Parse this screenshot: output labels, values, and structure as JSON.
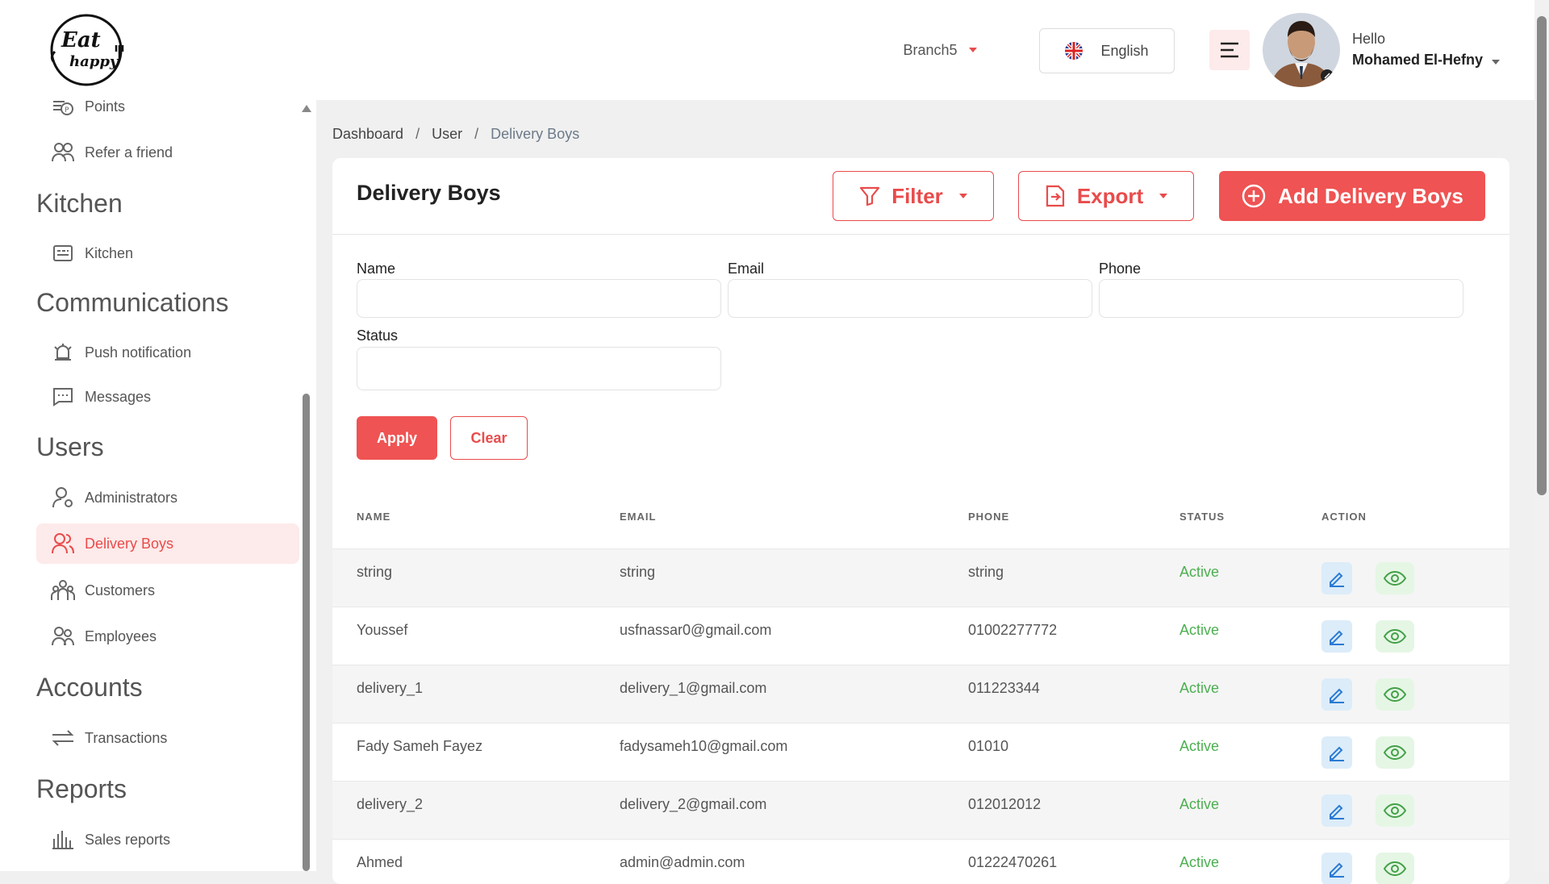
{
  "logo": {
    "line1": "Eat",
    "line2": "happy"
  },
  "sidebar": {
    "items_top": [
      {
        "label": "Points",
        "icon": "points-icon"
      },
      {
        "label": "Refer a friend",
        "icon": "refer-friend-icon"
      }
    ],
    "sections": [
      {
        "title": "Kitchen",
        "items": [
          {
            "label": "Kitchen",
            "icon": "kitchen-icon"
          }
        ]
      },
      {
        "title": "Communications",
        "items": [
          {
            "label": "Push notification",
            "icon": "bell-icon"
          },
          {
            "label": "Messages",
            "icon": "message-icon"
          }
        ]
      },
      {
        "title": "Users",
        "items": [
          {
            "label": "Administrators",
            "icon": "admin-icon"
          },
          {
            "label": "Delivery Boys",
            "icon": "delivery-icon",
            "active": true
          },
          {
            "label": "Customers",
            "icon": "customers-icon"
          },
          {
            "label": "Employees",
            "icon": "employees-icon"
          }
        ]
      },
      {
        "title": "Accounts",
        "items": [
          {
            "label": "Transactions",
            "icon": "transactions-icon"
          }
        ]
      },
      {
        "title": "Reports",
        "items": [
          {
            "label": "Sales reports",
            "icon": "sales-reports-icon"
          }
        ]
      }
    ]
  },
  "topbar": {
    "branch": "Branch5",
    "language": "English",
    "greeting": "Hello",
    "user_name": "Mohamed El-Hefny"
  },
  "breadcrumb": {
    "items": [
      "Dashboard",
      "User"
    ],
    "current": "Delivery Boys"
  },
  "page": {
    "title": "Delivery Boys",
    "filter_label": "Filter",
    "export_label": "Export",
    "add_label": "Add Delivery Boys"
  },
  "filters": {
    "name_label": "Name",
    "email_label": "Email",
    "phone_label": "Phone",
    "status_label": "Status",
    "apply_label": "Apply",
    "clear_label": "Clear"
  },
  "table": {
    "columns": [
      "NAME",
      "EMAIL",
      "PHONE",
      "STATUS",
      "ACTION"
    ],
    "rows": [
      {
        "name": "string",
        "email": "string",
        "phone": "string",
        "status": "Active"
      },
      {
        "name": "Youssef",
        "email": "usfnassar0@gmail.com",
        "phone": "01002277772",
        "status": "Active"
      },
      {
        "name": "delivery_1",
        "email": "delivery_1@gmail.com",
        "phone": "011223344",
        "status": "Active"
      },
      {
        "name": "Fady Sameh Fayez",
        "email": "fadysameh10@gmail.com",
        "phone": "01010",
        "status": "Active"
      },
      {
        "name": "delivery_2",
        "email": "delivery_2@gmail.com",
        "phone": "012012012",
        "status": "Active"
      },
      {
        "name": "Ahmed",
        "email": "admin@admin.com",
        "phone": "01222470261",
        "status": "Active"
      }
    ]
  },
  "colors": {
    "accent": "#ef5353",
    "active_status": "#4caf50",
    "edit_bg": "#dcecf9",
    "view_bg": "#e5f6e5"
  }
}
